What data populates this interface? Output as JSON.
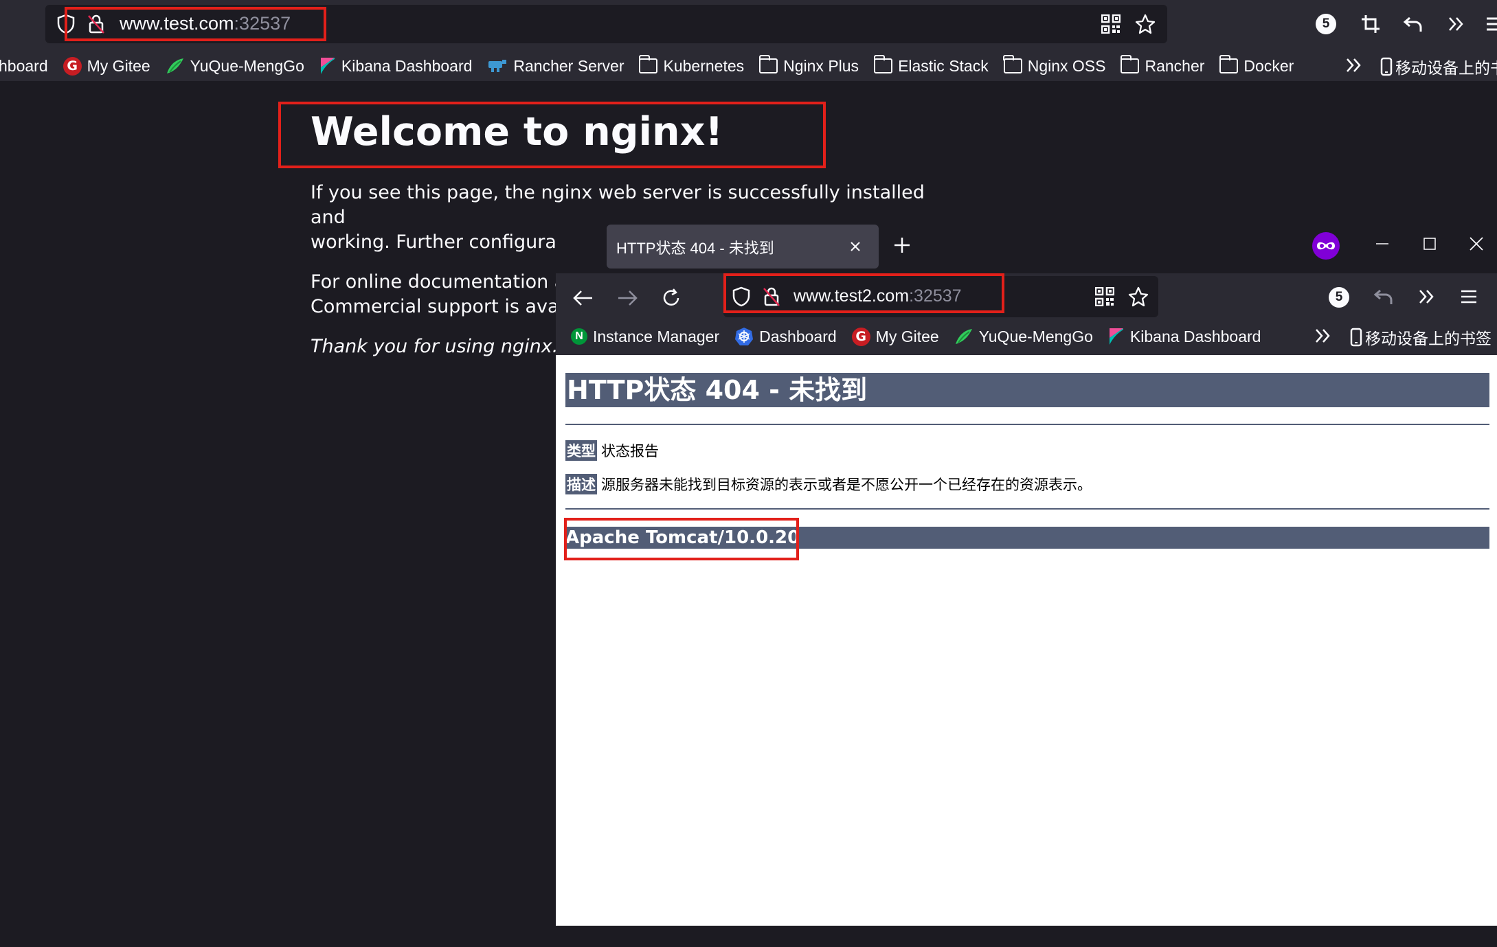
{
  "back_window": {
    "url_host": "www.test.com",
    "url_port": ":32537",
    "tabs_count": "5",
    "bookmarks": [
      {
        "label": "hboard",
        "icon": "none"
      },
      {
        "label": "My Gitee",
        "icon": "gitee-icon"
      },
      {
        "label": "YuQue-MengGo",
        "icon": "yuque-icon"
      },
      {
        "label": "Kibana Dashboard",
        "icon": "kibana-icon"
      },
      {
        "label": "Rancher Server",
        "icon": "rancher-icon"
      },
      {
        "label": "Kubernetes",
        "icon": "folder-icon"
      },
      {
        "label": "Nginx Plus",
        "icon": "folder-icon"
      },
      {
        "label": "Elastic Stack",
        "icon": "folder-icon"
      },
      {
        "label": "Nginx OSS",
        "icon": "folder-icon"
      },
      {
        "label": "Rancher",
        "icon": "folder-icon"
      },
      {
        "label": "Docker",
        "icon": "folder-icon"
      }
    ],
    "mobile_bookmarks": "移动设备上的书",
    "page": {
      "title": "Welcome to nginx!",
      "p1_line1": "If you see this page, the nginx web server is successfully installed and",
      "p1_line2": "working. Further configuration is required.",
      "p2_line1": "For online documentation an",
      "p2_line2": "Commercial support is availa",
      "p3": "Thank you for using nginx."
    }
  },
  "front_window": {
    "tab_title": "HTTP状态 404 - 未找到",
    "url_host": "www.test2.com",
    "url_port": ":32537",
    "tabs_count": "5",
    "bookmarks": [
      {
        "label": "Instance Manager",
        "icon": "nginx-n-icon"
      },
      {
        "label": "Dashboard",
        "icon": "kubernetes-icon"
      },
      {
        "label": "My Gitee",
        "icon": "gitee-icon"
      },
      {
        "label": "YuQue-MengGo",
        "icon": "yuque-icon"
      },
      {
        "label": "Kibana Dashboard",
        "icon": "kibana-icon"
      }
    ],
    "mobile_bookmarks": "移动设备上的书签",
    "page": {
      "heading": "HTTP状态 404 - 未找到",
      "type_label": "类型",
      "type_value": "状态报告",
      "desc_label": "描述",
      "desc_value": "源服务器未能找到目标资源的表示或者是不愿公开一个已经存在的资源表示。",
      "footer": "Apache Tomcat/10.0.20"
    }
  },
  "colors": {
    "browser_bg": "#1c1b22",
    "toolbar_bg": "#2b2a33",
    "tomcat_header": "#525d76",
    "highlight_red": "#e2201a"
  }
}
